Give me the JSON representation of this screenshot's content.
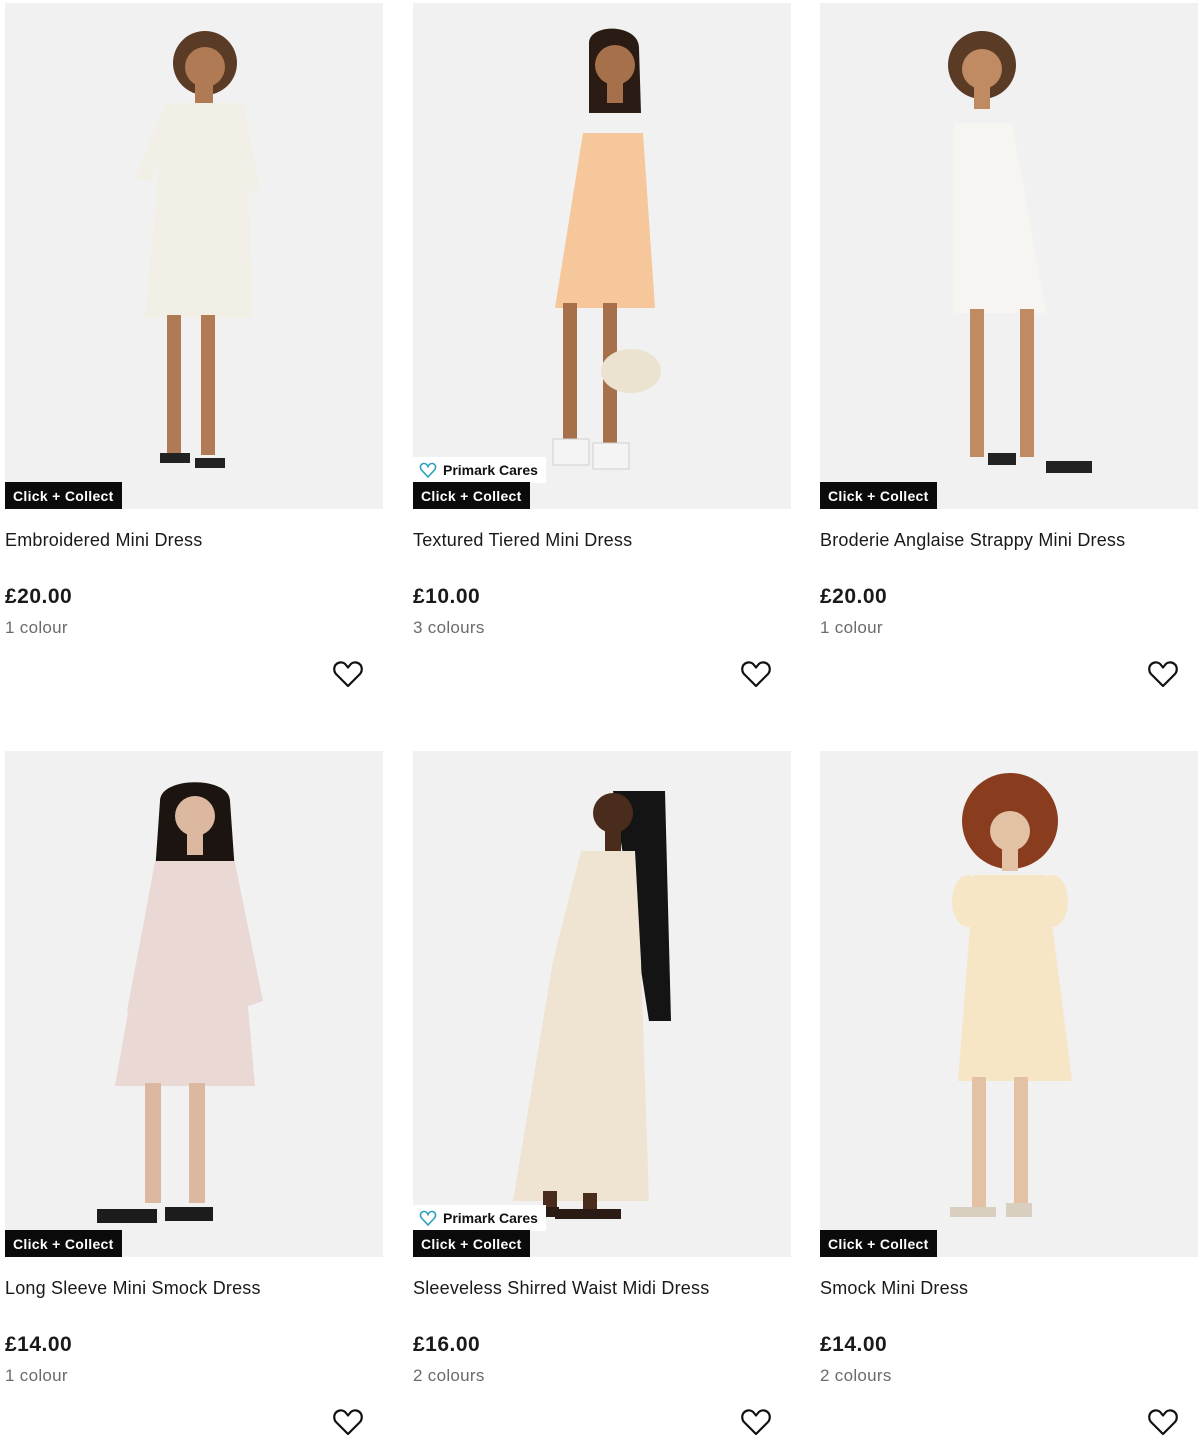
{
  "colors": {
    "badge_bg": "#0b0b0b",
    "image_bg": "#f1f1f1",
    "cares_heart": "#2a9fc0"
  },
  "products": [
    {
      "name": "Embroidered Mini Dress",
      "price": "£20.00",
      "colours": "1 colour",
      "badge": "Click + Collect",
      "cares": "",
      "dress_color": "#f2efe6",
      "icon": "heart-outline-icon"
    },
    {
      "name": "Textured Tiered Mini Dress",
      "price": "£10.00",
      "colours": "3 colours",
      "badge": "Click + Collect",
      "cares": "Primark Cares",
      "dress_color": "#f5c79a",
      "icon": "heart-outline-icon"
    },
    {
      "name": "Broderie Anglaise Strappy Mini Dress",
      "price": "£20.00",
      "colours": "1 colour",
      "badge": "Click + Collect",
      "cares": "",
      "dress_color": "#f6f5f1",
      "icon": "heart-outline-icon"
    },
    {
      "name": "Long Sleeve Mini Smock Dress",
      "price": "£14.00",
      "colours": "1 colour",
      "badge": "Click + Collect",
      "cares": "",
      "dress_color": "#e9d8d4",
      "icon": "heart-outline-icon"
    },
    {
      "name": "Sleeveless Shirred Waist Midi Dress",
      "price": "£16.00",
      "colours": "2 colours",
      "badge": "Click + Collect",
      "cares": "Primark Cares",
      "dress_color": "#efe4d2",
      "icon": "heart-outline-icon"
    },
    {
      "name": "Smock Mini Dress",
      "price": "£14.00",
      "colours": "2 colours",
      "badge": "Click + Collect",
      "cares": "",
      "dress_color": "#f6e6c6",
      "icon": "heart-outline-icon"
    }
  ]
}
